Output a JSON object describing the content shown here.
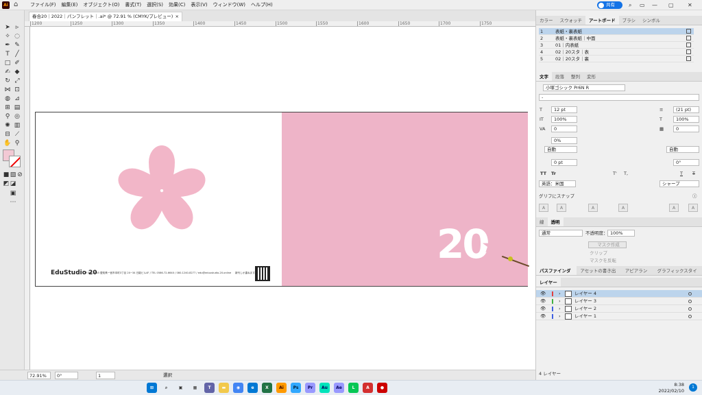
{
  "menubar": {
    "app_icon": "Ai",
    "items": [
      "ファイル(F)",
      "編集(E)",
      "オブジェクト(O)",
      "書式(T)",
      "選択(S)",
      "効果(C)",
      "表示(V)",
      "ウィンドウ(W)",
      "ヘルプ(H)"
    ],
    "share_label": "共有"
  },
  "document": {
    "tab_title": "春合20｜2022｜パンフレット｜.ai* @ 72.91 % (CMYK/プレビュー)",
    "close": "×"
  },
  "ruler": {
    "h_labels": [
      "1200",
      "1250",
      "1300",
      "1350",
      "1400",
      "1450",
      "1500",
      "1550",
      "1600",
      "1650",
      "1700",
      "1750"
    ]
  },
  "artboard": {
    "brand": "EduStudio 20",
    "address": "〒463-0045 愛知県一宮市本町3丁目 20−34 日能ビル4F / TEL 0586-72-6640 / 080-1240-8277 / edu@eduustudio-20.online",
    "note": "新刊しか重ねます。",
    "big_number": "20"
  },
  "statusbar": {
    "zoom": "72.91%",
    "angle": "0°",
    "page": "1",
    "mode": "選択"
  },
  "panels": {
    "top_tabs": [
      "カラー",
      "スウォッチ",
      "アートボード",
      "ブラシ",
      "シンボル"
    ],
    "artboards": [
      {
        "n": "1",
        "name": "表紙・裏表紙"
      },
      {
        "n": "2",
        "name": "表紙・裏表紙｜中面"
      },
      {
        "n": "3",
        "name": "01｜内表紙"
      },
      {
        "n": "4",
        "name": "02｜20スタ｜表"
      },
      {
        "n": "5",
        "name": "02｜20スタ｜裏"
      }
    ],
    "char_tabs": [
      "文字",
      "段落",
      "整列",
      "変形"
    ],
    "font": "小塚ゴシック Pr6N R",
    "font_style": "-",
    "size": "12 pt",
    "leading": "(21 pt)",
    "vscale": "100%",
    "hscale": "100%",
    "kerning": "0",
    "tracking": "0",
    "tsume": "0%",
    "aki_left": "自動",
    "aki_right": "自動",
    "baseline": "0 pt",
    "rotate": "0°",
    "style_buttons": [
      "TT",
      "Tr",
      "T'",
      "T,",
      "T",
      "T"
    ],
    "language": "英語：米国",
    "antialias": "シャープ",
    "snap_label": "グリフにスナップ",
    "transparency_tabs": [
      "線",
      "透明"
    ],
    "blend": "通常",
    "opacity_label": "不透明度：",
    "opacity": "100%",
    "mask_button": "マスク作成",
    "clip": "クリップ",
    "invert": "マスクを反転",
    "bottom_tabs": [
      "パスファインダー",
      "アセットの書き出し",
      "アピアランス",
      "グラフィックスタイル"
    ],
    "layers_tab": "レイヤー",
    "layers": [
      {
        "name": "レイヤー 4",
        "color": "#e04040"
      },
      {
        "name": "レイヤー 3",
        "color": "#40b040"
      },
      {
        "name": "レイヤー 2",
        "color": "#4060e0"
      },
      {
        "name": "レイヤー 1",
        "color": "#4060e0"
      }
    ],
    "layer_count": "4 レイヤー"
  },
  "taskbar": {
    "time": "8:38",
    "date": "2022/02/10",
    "badge": "1"
  }
}
